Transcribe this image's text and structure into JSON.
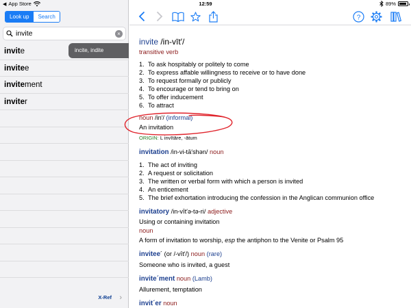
{
  "status_bar": {
    "carrier": "App Store",
    "time": "12:59",
    "battery": "89%",
    "battery_level": 0.89
  },
  "sidebar": {
    "tabs": [
      "Look up",
      "Search"
    ],
    "active_tab": "Look up",
    "search": {
      "value": "invite",
      "placeholder": ""
    },
    "suggestion": "incite, indite",
    "results": [
      {
        "bold": "invit",
        "rest": "e"
      },
      {
        "bold": "invite",
        "rest": "e"
      },
      {
        "bold": "invite",
        "rest": "ment"
      },
      {
        "bold": "invite",
        "rest": "r"
      }
    ],
    "xref": "X-Ref"
  },
  "toolbar": {
    "icons": [
      "back-icon",
      "forward-icon",
      "book-icon",
      "star-icon",
      "share-icon",
      "help-icon",
      "gear-icon",
      "library-icon"
    ]
  },
  "entry": {
    "headword": "invite",
    "pron": " /in-vīt′/",
    "pos": "transitive verb",
    "senses": [
      "To ask hospitably or politely to come",
      "To express affable willingness to receive or to have done",
      "To request formally or publicly",
      "To encourage or tend to bring on",
      "To offer inducement",
      "To attract"
    ],
    "noun_label": "noun",
    "noun_pron": " /in′/ ",
    "noun_register": "(informal)",
    "noun_def": "An invitation",
    "origin_label": "ORIGIN:",
    "origin_text": " L invītāre, -ātum",
    "derived": [
      {
        "word": "invitation",
        "pron": " /in-vi-tā′shən/ ",
        "pos": "noun",
        "senses": [
          "The act of inviting",
          "A request or solicitation",
          "The written or verbal form with which a person is invited",
          "An enticement",
          "The brief exhortation introducing the confession in the Anglican communion office"
        ]
      }
    ],
    "invitatory": {
      "word": "invitatory",
      "pron": " /in-vīt′ə-tə-ri/ ",
      "pos": "adjective",
      "def1": "Using or containing invitation",
      "pos2": "noun",
      "def2_a": "A form of invitation to worship, ",
      "def2_esp": "esp",
      "def2_b": " the antiphon to the Venite or Psalm 95"
    },
    "invitee": {
      "word": "invitee",
      "mark": "´",
      "alt": " (or /-vīt′/) ",
      "pos": "noun",
      "register": " (rare)",
      "def": "Someone who is invited, a guest"
    },
    "invitement": {
      "word": "invite´ment",
      "pos": " noun",
      "register": " (Lamb)",
      "def": "Allurement, temptation"
    },
    "inviter": {
      "word": "invit´er",
      "pos": " noun"
    }
  },
  "colors": {
    "accent": "#1a7cf5",
    "headword": "#1c3f8f",
    "pos": "#8b1a1a",
    "origin": "#1f7a1f",
    "annotation": "#e0242c"
  }
}
